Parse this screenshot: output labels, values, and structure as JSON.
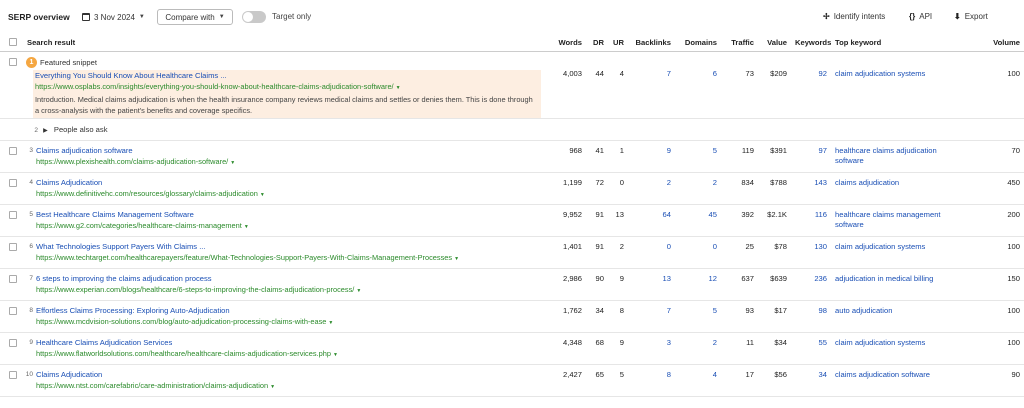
{
  "toolbar": {
    "title": "SERP overview",
    "date": "3 Nov 2024",
    "compare_label": "Compare with",
    "target_only_label": "Target only",
    "target_only_on": false,
    "identify_intents_label": "Identify intents",
    "api_label": "API",
    "export_label": "Export"
  },
  "columns": {
    "search_result": "Search result",
    "words": "Words",
    "dr": "DR",
    "ur": "UR",
    "backlinks": "Backlinks",
    "domains": "Domains",
    "traffic": "Traffic",
    "value": "Value",
    "keywords": "Keywords",
    "top_keyword": "Top keyword",
    "volume": "Volume"
  },
  "featured": {
    "position": "1",
    "label": "Featured snippet",
    "title": "Everything You Should Know About Healthcare Claims ...",
    "url": "https://www.osplabs.com/insights/everything-you-should-know-about-healthcare-claims-adjudication-software/",
    "text": "Introduction. Medical claims adjudication is when the health insurance company reviews medical claims and settles or denies them. This is done through a cross-analysis with the patient's benefits and coverage specifics.",
    "words": "4,003",
    "dr": "44",
    "ur": "4",
    "backlinks": "7",
    "domains": "6",
    "traffic": "73",
    "value": "$209",
    "keywords": "92",
    "top_keyword": "claim adjudication systems",
    "volume": "100"
  },
  "people_also_ask": {
    "position": "2",
    "label": "People also ask"
  },
  "rows": [
    {
      "position": "3",
      "title": "Claims adjudication software",
      "url": "https://www.plexishealth.com/claims-adjudication-software/",
      "words": "968",
      "dr": "41",
      "ur": "1",
      "backlinks": "9",
      "domains": "5",
      "traffic": "119",
      "value": "$391",
      "keywords": "97",
      "top_keyword": "healthcare claims adjudication software",
      "volume": "70"
    },
    {
      "position": "4",
      "title": "Claims Adjudication",
      "url": "https://www.definitivehc.com/resources/glossary/claims-adjudication",
      "words": "1,199",
      "dr": "72",
      "ur": "0",
      "backlinks": "2",
      "domains": "2",
      "traffic": "834",
      "value": "$788",
      "keywords": "143",
      "top_keyword": "claims adjudication",
      "volume": "450"
    },
    {
      "position": "5",
      "title": "Best Healthcare Claims Management Software",
      "url": "https://www.g2.com/categories/healthcare-claims-management",
      "words": "9,952",
      "dr": "91",
      "ur": "13",
      "backlinks": "64",
      "domains": "45",
      "traffic": "392",
      "value": "$2.1K",
      "keywords": "116",
      "top_keyword": "healthcare claims management software",
      "volume": "200"
    },
    {
      "position": "6",
      "title": "What Technologies Support Payers With Claims ...",
      "url": "https://www.techtarget.com/healthcarepayers/feature/What-Technologies-Support-Payers-With-Claims-Management-Processes",
      "words": "1,401",
      "dr": "91",
      "ur": "2",
      "backlinks": "0",
      "domains": "0",
      "traffic": "25",
      "value": "$78",
      "keywords": "130",
      "top_keyword": "claim adjudication systems",
      "volume": "100"
    },
    {
      "position": "7",
      "title": "6 steps to improving the claims adjudication process",
      "url": "https://www.experian.com/blogs/healthcare/6-steps-to-improving-the-claims-adjudication-process/",
      "words": "2,986",
      "dr": "90",
      "ur": "9",
      "backlinks": "13",
      "domains": "12",
      "traffic": "637",
      "value": "$639",
      "keywords": "236",
      "top_keyword": "adjudication in medical billing",
      "volume": "150"
    },
    {
      "position": "8",
      "title": "Effortless Claims Processing: Exploring Auto-Adjudication",
      "url": "https://www.mcdvision-solutions.com/blog/auto-adjudication-processing-claims-with-ease",
      "words": "1,762",
      "dr": "34",
      "ur": "8",
      "backlinks": "7",
      "domains": "5",
      "traffic": "93",
      "value": "$17",
      "keywords": "98",
      "top_keyword": "auto adjudication",
      "volume": "100"
    },
    {
      "position": "9",
      "title": "Healthcare Claims Adjudication Services",
      "url": "https://www.flatworldsolutions.com/healthcare/healthcare-claims-adjudication-services.php",
      "words": "4,348",
      "dr": "68",
      "ur": "9",
      "backlinks": "3",
      "domains": "2",
      "traffic": "11",
      "value": "$34",
      "keywords": "55",
      "top_keyword": "claim adjudication systems",
      "volume": "100"
    },
    {
      "position": "10",
      "title": "Claims Adjudication",
      "url": "https://www.ntst.com/carefabric/care-administration/claims-adjudication",
      "words": "2,427",
      "dr": "65",
      "ur": "5",
      "backlinks": "8",
      "domains": "4",
      "traffic": "17",
      "value": "$56",
      "keywords": "34",
      "top_keyword": "claims adjudication software",
      "volume": "90"
    }
  ]
}
